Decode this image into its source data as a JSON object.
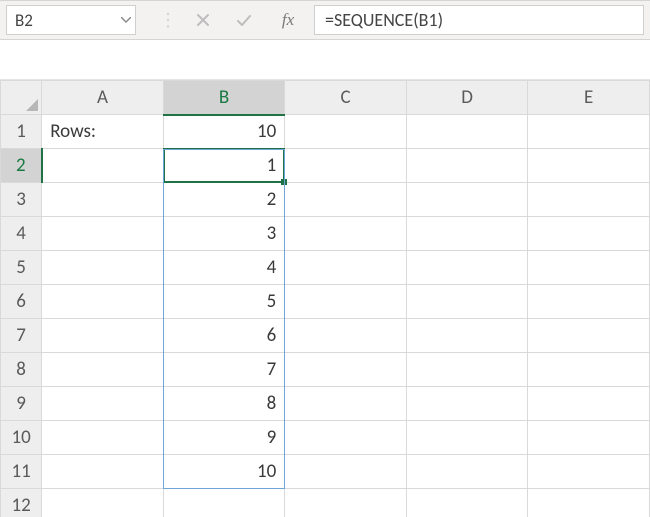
{
  "namebox": {
    "value": "B2"
  },
  "formula_bar": {
    "formula": "=SEQUENCE(B1)",
    "fx_label": "fx"
  },
  "columns": [
    "A",
    "B",
    "C",
    "D",
    "E"
  ],
  "rows": [
    "1",
    "2",
    "3",
    "4",
    "5",
    "6",
    "7",
    "8",
    "9",
    "10",
    "11",
    "12"
  ],
  "cells": {
    "A1": "Rows:",
    "B1": "10",
    "B2": "1",
    "B3": "2",
    "B4": "3",
    "B5": "4",
    "B6": "5",
    "B7": "6",
    "B8": "7",
    "B9": "8",
    "B10": "9",
    "B11": "10"
  },
  "selection": {
    "active_cell": "B2",
    "active_col": "B",
    "active_row": "2"
  },
  "spill_range": {
    "start": "B2",
    "end": "B11"
  }
}
